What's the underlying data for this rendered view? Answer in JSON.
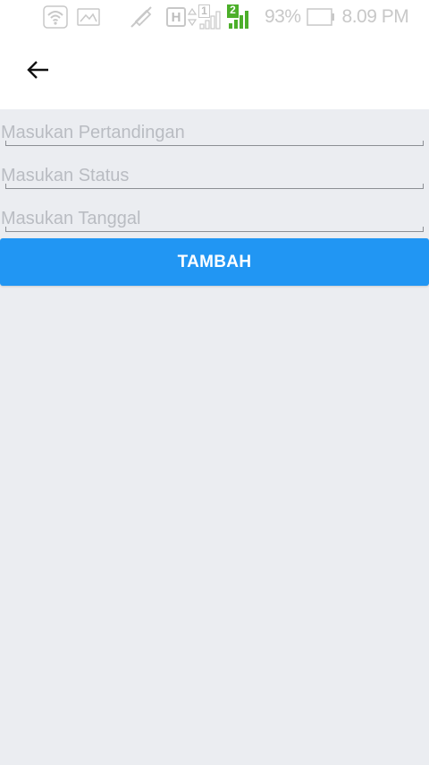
{
  "status_bar": {
    "icons": [
      "wifi-icon",
      "image-icon",
      "mute-icon",
      "h-network-icon",
      "data-arrows-icon",
      "sim1-signal-icon",
      "sim2-signal-icon",
      "battery-icon"
    ],
    "sim1_label": "1",
    "sim2_label": "2",
    "network_type": "H",
    "battery_percent": "93%",
    "time": "8.09 PM",
    "colors": {
      "icons": "#c8c8c8",
      "sim2_active": "#4caf2a"
    }
  },
  "app_bar": {
    "back_icon": "arrow-left-icon"
  },
  "form": {
    "fields": [
      {
        "placeholder": "Masukan Pertandingan",
        "value": ""
      },
      {
        "placeholder": "Masukan Status",
        "value": ""
      },
      {
        "placeholder": "Masukan Tanggal",
        "value": ""
      }
    ],
    "submit_label": "TAMBAH"
  },
  "colors": {
    "background": "#ebedf1",
    "app_bar": "#ffffff",
    "accent": "#2196f3",
    "button_text": "#ffffff",
    "placeholder": "#b9bcc2"
  }
}
